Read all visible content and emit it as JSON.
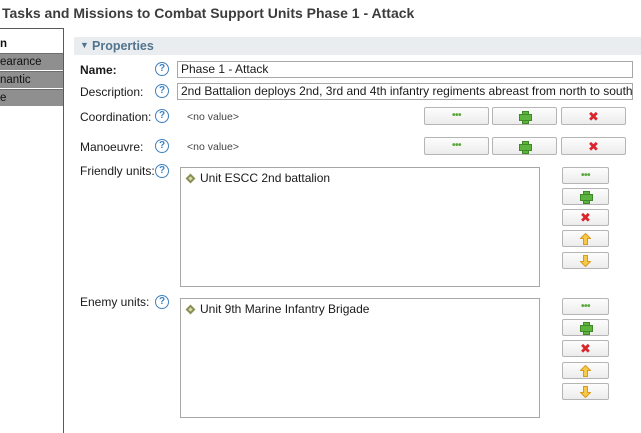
{
  "page": {
    "title": "Tasks and Missions to Combat Support Units Phase 1  - Attack"
  },
  "left_tabs": [
    {
      "label": "n"
    },
    {
      "label": "earance"
    },
    {
      "label": "nantic"
    },
    {
      "label": "e"
    }
  ],
  "properties": {
    "header": "Properties",
    "name": {
      "label": "Name:",
      "value": "Phase 1  - Attack"
    },
    "description": {
      "label": "Description:",
      "value": "2nd Battalion deploys 2nd, 3rd and 4th infantry regiments abreast from north to south"
    },
    "coordination": {
      "label": "Coordination:",
      "value": "<no value>"
    },
    "manoeuvre": {
      "label": "Manoeuvre:",
      "value": "<no value>"
    },
    "friendly_units": {
      "label": "Friendly units:",
      "items": [
        "Unit ESCC 2nd battalion"
      ]
    },
    "enemy_units": {
      "label": "Enemy units:",
      "items": [
        "Unit 9th Marine Infantry Brigade"
      ]
    }
  },
  "icons": {
    "help": "help-question-icon",
    "browse": "ellipsis-icon",
    "add": "plus-icon",
    "remove": "red-cross-icon",
    "move_up": "arrow-up-icon",
    "move_down": "arrow-down-icon",
    "unit": "unit-diamond-icon"
  },
  "colors": {
    "section_header_bg": "#e9edf0",
    "section_header_text": "#53748d",
    "help_icon": "#3f7fc0",
    "add_green": "#5cb43e",
    "remove_red": "#d9262c",
    "arrow_orange": "#f0b429",
    "tab_inactive_bg": "#8f8f8f"
  }
}
